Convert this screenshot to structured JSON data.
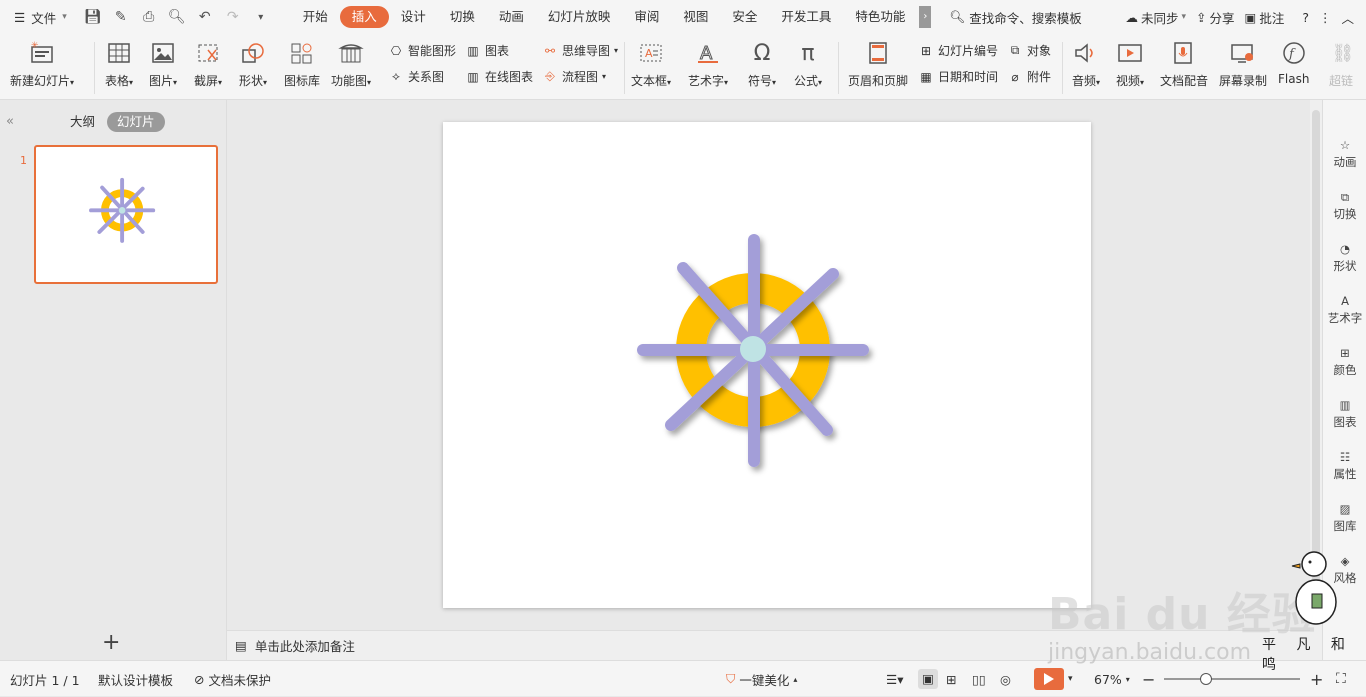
{
  "menubar": {
    "file_label": "文件",
    "tabs": [
      "开始",
      "插入",
      "设计",
      "切换",
      "动画",
      "幻灯片放映",
      "审阅",
      "视图",
      "安全",
      "开发工具",
      "特色功能"
    ],
    "active_tab": "插入",
    "search_label": "查找命令、搜索模板",
    "sync_label": "未同步",
    "share_label": "分享",
    "comment_label": "批注",
    "help_label": "?"
  },
  "ribbon": {
    "new_slide": "新建幻灯片",
    "table": "表格",
    "picture": "图片",
    "screenshot": "截屏",
    "shape": "形状",
    "icon_lib": "图标库",
    "func_chart": "功能图",
    "smart_shape": "智能图形",
    "chart": "图表",
    "mind_map": "思维导图",
    "relation": "关系图",
    "online_chart": "在线图表",
    "flowchart": "流程图",
    "textbox": "文本框",
    "wordart": "艺术字",
    "symbol": "符号",
    "formula": "公式",
    "header_footer": "页眉和页脚",
    "slide_number": "幻灯片编号",
    "object": "对象",
    "date_time": "日期和时间",
    "attachment": "附件",
    "audio": "音频",
    "video": "视频",
    "doc_dub": "文档配音",
    "screen_rec": "屏幕录制",
    "flash": "Flash",
    "hyperlink": "超链"
  },
  "left_panel": {
    "outline_tab": "大纲",
    "slides_tab": "幻灯片",
    "slide_number": "1",
    "add_label": "+"
  },
  "notes": {
    "placeholder": "单击此处添加备注"
  },
  "right_panel": [
    "动画",
    "切换",
    "形状",
    "艺术字",
    "颜色",
    "图表",
    "属性",
    "图库",
    "风格"
  ],
  "status": {
    "slide_info": "幻灯片 1 / 1",
    "template": "默认设计模板",
    "protect": "文档未保护",
    "beautify": "一键美化",
    "zoom": "67%"
  },
  "watermark": {
    "brand": "Bai du 经验",
    "url": "jingyan.baidu.com",
    "author": "平 凡 和 鸣"
  },
  "colors": {
    "accent": "#e86b3d",
    "ring": "#ffc000",
    "spokes": "#a39ed8",
    "hub": "#bfe3e4"
  }
}
